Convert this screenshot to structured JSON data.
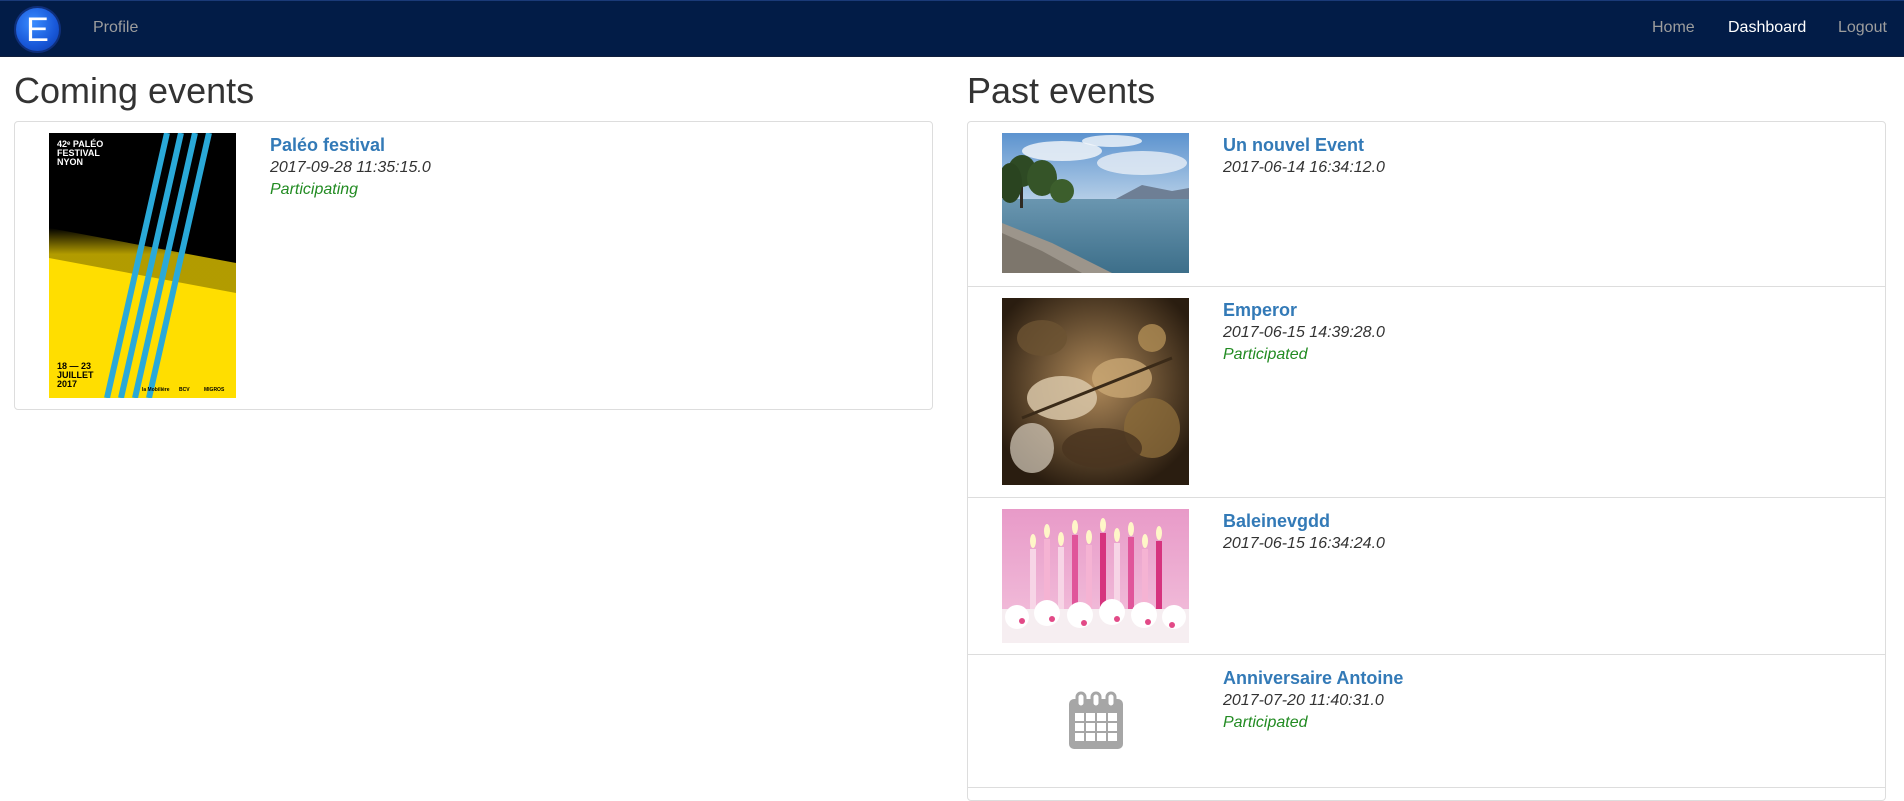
{
  "navbar": {
    "brand_letter": "E",
    "profile_label": "Profile",
    "home_label": "Home",
    "dashboard_label": "Dashboard",
    "logout_label": "Logout",
    "background_color": "#021c47"
  },
  "coming": {
    "heading": "Coming events",
    "events": [
      {
        "title": "Paléo festival",
        "date": "2017-09-28 11:35:15.0",
        "status": "Participating",
        "poster": {
          "line1": "42ᵉ PALÉO",
          "line2": "FESTIVAL",
          "line3": "NYON",
          "dates_line1": "18 — 23",
          "dates_line2": "JUILLET",
          "dates_line3": "2017",
          "sponsor1": "la Mobilière",
          "sponsor2": "BCV",
          "sponsor3": "MIGROS"
        }
      }
    ]
  },
  "past": {
    "heading": "Past events",
    "events": [
      {
        "title": "Un nouvel Event",
        "date": "2017-06-14 16:34:12.0",
        "status": ""
      },
      {
        "title": "Emperor",
        "date": "2017-06-15 14:39:28.0",
        "status": "Participated"
      },
      {
        "title": "Baleinevgdd",
        "date": "2017-06-15 16:34:24.0",
        "status": ""
      },
      {
        "title": "Anniversaire Antoine",
        "date": "2017-07-20 11:40:31.0",
        "status": "Participated"
      }
    ]
  },
  "colors": {
    "link": "#337ab7",
    "status": "#228b22",
    "border": "#dddddd"
  }
}
